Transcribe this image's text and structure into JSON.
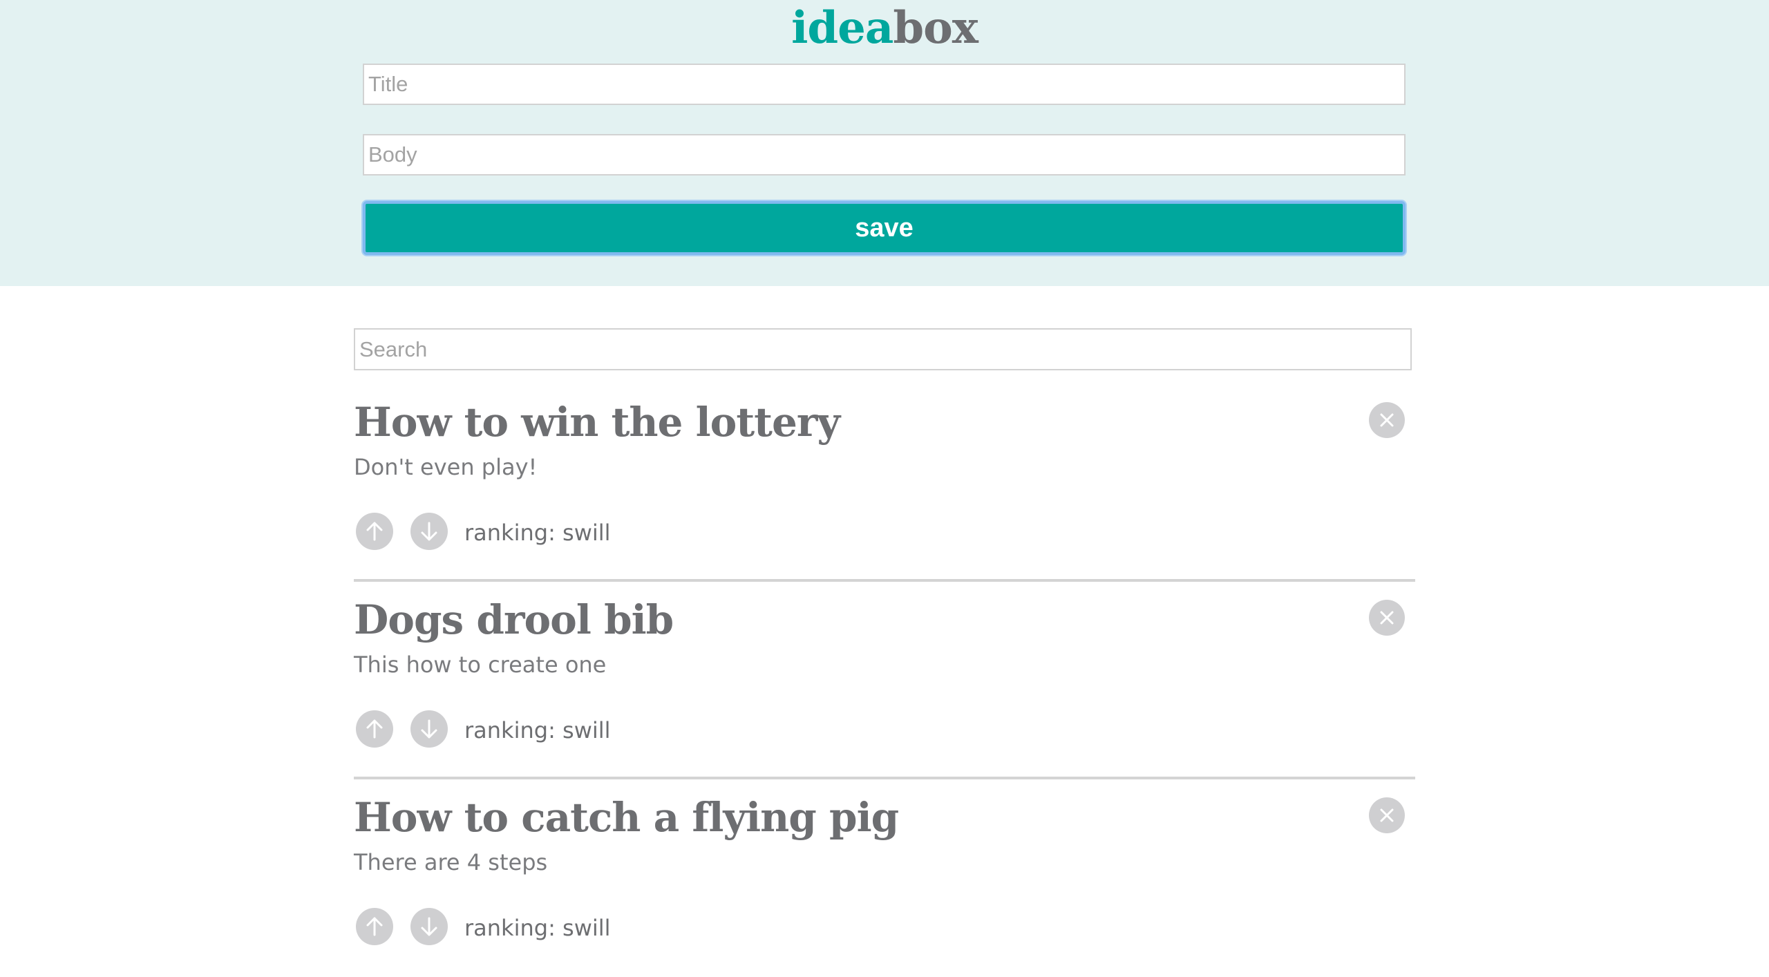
{
  "header": {
    "logo_part1": "idea",
    "logo_part2": "box",
    "title_placeholder": "Title",
    "body_placeholder": "Body",
    "save_label": "save"
  },
  "search": {
    "placeholder": "Search"
  },
  "ideas": [
    {
      "title": "How to win the lottery",
      "body": "Don't even play!",
      "ranking": "ranking: swill"
    },
    {
      "title": "Dogs drool bib",
      "body": "This how to create one",
      "ranking": "ranking: swill"
    },
    {
      "title": "How to catch a flying pig",
      "body": "There are 4 steps",
      "ranking": "ranking: swill"
    }
  ],
  "icons": {
    "delete": "close-icon",
    "upvote": "arrow-up-icon",
    "downvote": "arrow-down-icon"
  },
  "colors": {
    "accent": "#00a79d",
    "text": "#6d6e71",
    "header_bg": "#e3f2f2",
    "icon_bg": "#cfcfd1"
  }
}
